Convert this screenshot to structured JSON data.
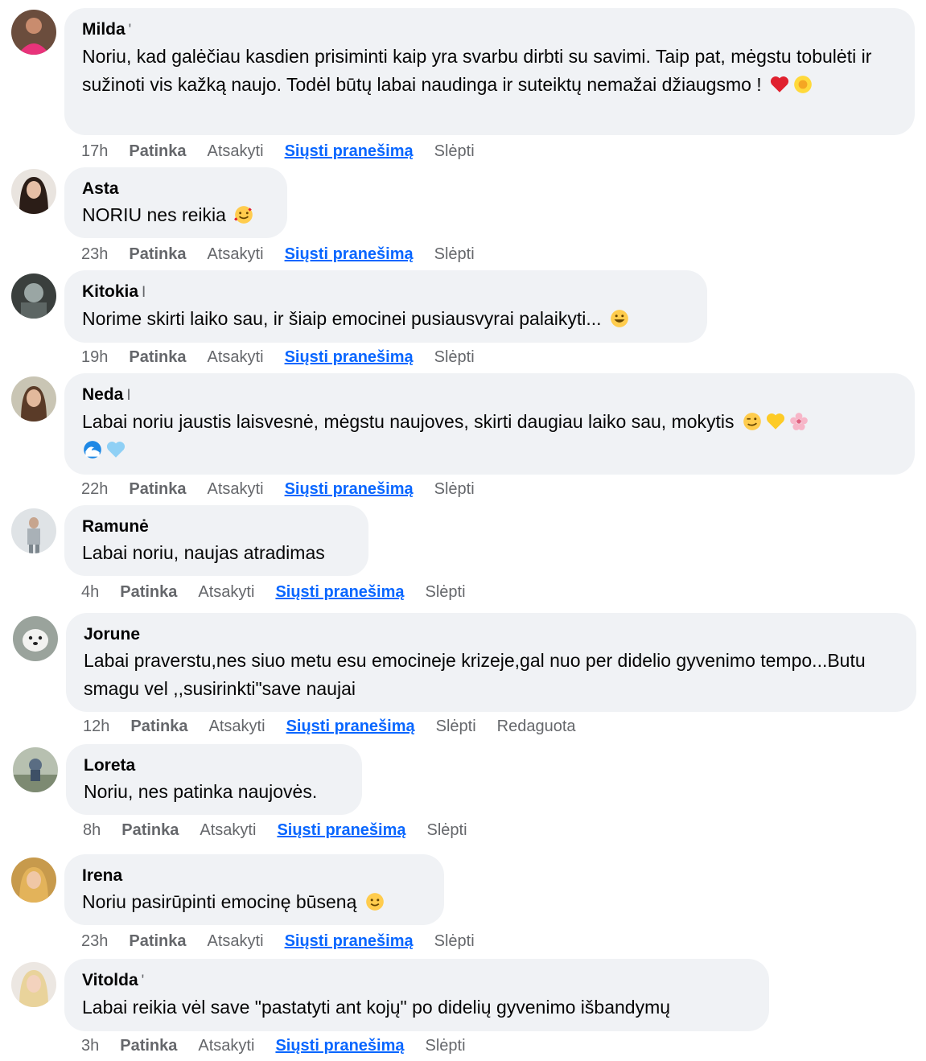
{
  "comments": [
    {
      "author": "Milda",
      "text": "Noriu, kad galėčiau kasdien prisiminti kaip yra svarbu dirbti su savimi. Taip pat, mėgstu tobulėti ir sužinoti vis kažką naujo. Todėl būtų labai naudinga ir suteiktų nemažai džiaugsmo !",
      "emojis": [
        "red-heart-emoji",
        "sunflower-emoji"
      ],
      "time": "17h",
      "like": "Patinka",
      "reply": "Atsakyti",
      "send": "Siųsti pranešimą",
      "hide": "Slėpti"
    },
    {
      "author": "Asta",
      "text": "NORIU nes reikia",
      "emojis": [
        "smiling-face-with-hearts-emoji"
      ],
      "time": "23h",
      "like": "Patinka",
      "reply": "Atsakyti",
      "send": "Siųsti pranešimą",
      "hide": "Slėpti"
    },
    {
      "author": "Kitokia",
      "text": "Norime skirti laiko sau, ir šiaip emocinei pusiausvyrai palaikyti...",
      "emojis": [
        "grinning-face-emoji"
      ],
      "time": "19h",
      "like": "Patinka",
      "reply": "Atsakyti",
      "send": "Siųsti pranešimą",
      "hide": "Slėpti"
    },
    {
      "author": "Neda",
      "text": "Labai noriu jaustis laisvesnė, mėgstu naujoves, skirti daugiau laiko sau, mokytis",
      "emojis": [
        "winking-face-emoji",
        "yellow-heart-emoji",
        "cherry-blossom-emoji",
        "wave-emoji",
        "light-blue-heart-emoji"
      ],
      "time": "22h",
      "like": "Patinka",
      "reply": "Atsakyti",
      "send": "Siųsti pranešimą",
      "hide": "Slėpti"
    },
    {
      "author": "Ramunė",
      "text": "Labai noriu, naujas atradimas",
      "emojis": [],
      "time": "4h",
      "like": "Patinka",
      "reply": "Atsakyti",
      "send": "Siųsti pranešimą",
      "hide": "Slėpti"
    },
    {
      "author": "Jorune",
      "text": "Labai praverstu,nes siuo metu esu emocineje krizeje,gal nuo per didelio gyvenimo tempo...Butu smagu vel ,,susirinkti\"save naujai",
      "emojis": [],
      "time": "12h",
      "like": "Patinka",
      "reply": "Atsakyti",
      "send": "Siųsti pranešimą",
      "hide": "Slėpti",
      "edited": "Redaguota"
    },
    {
      "author": "Loreta",
      "text": "Noriu, nes patinka naujovės.",
      "emojis": [],
      "time": "8h",
      "like": "Patinka",
      "reply": "Atsakyti",
      "send": "Siųsti pranešimą",
      "hide": "Slėpti"
    },
    {
      "author": "Irena",
      "text": "Noriu pasirūpinti emocinę būseną",
      "emojis": [
        "slightly-smiling-face-emoji"
      ],
      "time": "23h",
      "like": "Patinka",
      "reply": "Atsakyti",
      "send": "Siųsti pranešimą",
      "hide": "Slėpti"
    },
    {
      "author": "Vitolda",
      "text": "Labai reikia vėl save \"pastatyti ant kojų\" po didelių gyvenimo išbandymų",
      "emojis": [],
      "time": "3h",
      "like": "Patinka",
      "reply": "Atsakyti",
      "send": "Siųsti pranešimą",
      "hide": "Slėpti"
    }
  ],
  "colors": {
    "bubble": "#f0f2f5",
    "secondary_text": "#65676b",
    "link": "#0866ff"
  }
}
